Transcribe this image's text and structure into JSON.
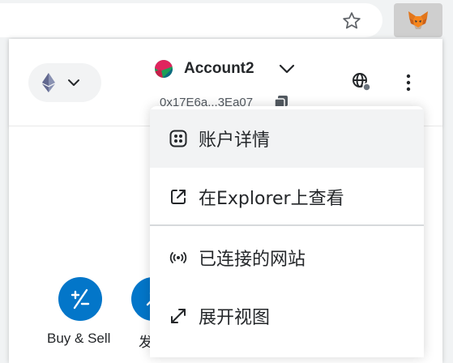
{
  "account": {
    "name": "Account2",
    "address": "0x17E6a...3Ea07"
  },
  "actions": [
    {
      "label": "Buy & Sell"
    },
    {
      "label": "发"
    }
  ],
  "menu": {
    "items": [
      {
        "label": "账户详情",
        "icon": "account-details-icon"
      },
      {
        "label": "在Explorer上查看",
        "icon": "external-link-icon"
      },
      {
        "label": "已连接的网站",
        "icon": "connected-sites-icon"
      },
      {
        "label": "展开视图",
        "icon": "expand-view-icon"
      }
    ]
  },
  "colors": {
    "accent": "#0376c9",
    "hover": "#f2f3f4",
    "text": "#24272a"
  }
}
